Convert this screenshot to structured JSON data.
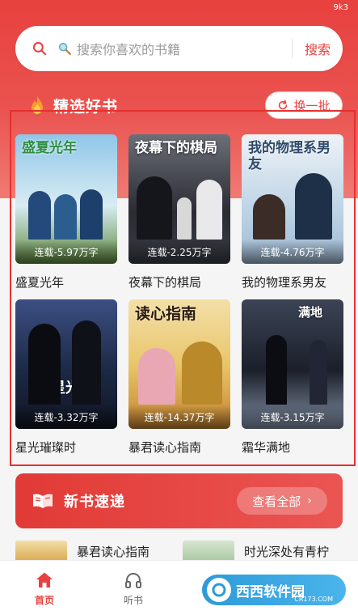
{
  "status": {
    "text": "9k3"
  },
  "search": {
    "placeholder": "搜索你喜欢的书籍",
    "button_label": "搜索"
  },
  "featured": {
    "title": "精选好书",
    "refresh_label": "换一批",
    "books": [
      {
        "cover_title": "盛夏光年",
        "badge": "连载-5.97万字",
        "name": "盛夏光年",
        "cover_colors": [
          "#8fc6e8",
          "#d8ecf3",
          "#5f8a3d"
        ]
      },
      {
        "cover_title": "夜幕下的棋局",
        "badge": "连载-2.25万字",
        "name": "夜幕下的棋局",
        "cover_colors": [
          "#2b2b33",
          "#6b6f78",
          "#3a3d46"
        ]
      },
      {
        "cover_title": "我的物理系男友",
        "badge": "连载-4.76万字",
        "name": "我的物理系男友",
        "cover_colors": [
          "#eef2f6",
          "#bcd3e6",
          "#2e4a6a"
        ]
      },
      {
        "cover_title": "星光",
        "badge": "连载-3.32万字",
        "name": "星光璀璨时",
        "cover_colors": [
          "#1c2946",
          "#3c4f82",
          "#111522"
        ]
      },
      {
        "cover_title": "读心指南",
        "badge": "连载-14.37万字",
        "name": "暴君读心指南",
        "cover_colors": [
          "#e9c66b",
          "#c4832f",
          "#f3dfa8"
        ]
      },
      {
        "cover_title": "满地",
        "badge": "连载-3.15万字",
        "name": "霜华满地",
        "cover_colors": [
          "#1b1f2a",
          "#3c4456",
          "#8592a8"
        ]
      }
    ]
  },
  "new_books": {
    "title": "新书速递",
    "view_all_label": "查看全部",
    "items": [
      {
        "title": "暴君读心指南",
        "thumb_color": "#d9a84f"
      },
      {
        "title": "时光深处有青柠",
        "thumb_color": "#a9c7a0"
      }
    ]
  },
  "tabbar": {
    "tabs": [
      {
        "label": "首页",
        "icon": "home-icon",
        "active": true
      },
      {
        "label": "听书",
        "icon": "headphones-icon",
        "active": false
      }
    ]
  },
  "watermark": {
    "text": "西西软件园",
    "sub": "CR173.COM"
  },
  "colors": {
    "accent": "#e8413e",
    "highlight": "#e53030"
  }
}
